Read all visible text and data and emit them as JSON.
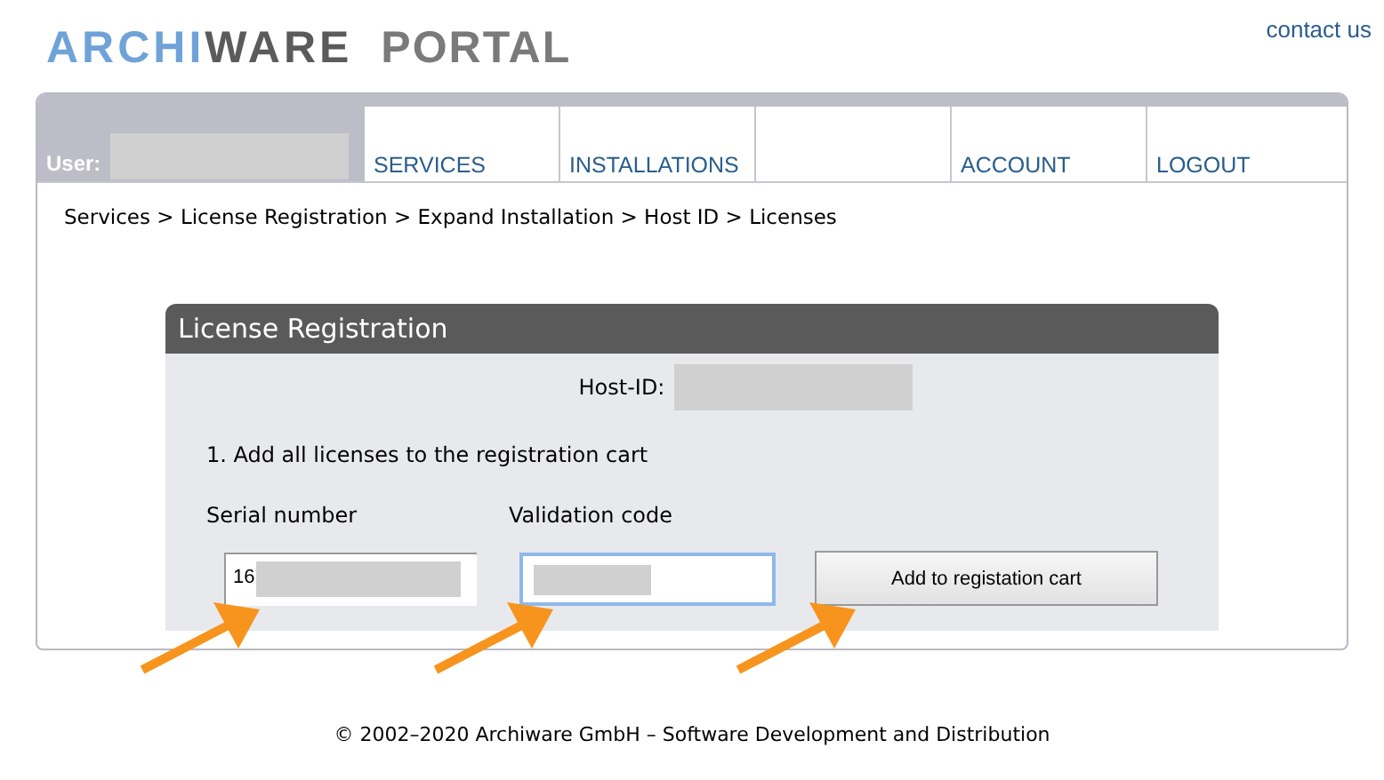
{
  "header": {
    "logo": {
      "part_1": "ARCHI",
      "part_2": "WARE",
      "product": "PORTAL"
    },
    "contact_link": "contact us"
  },
  "nav": {
    "user_label": "User:",
    "items": [
      {
        "kind": "link",
        "label": "SERVICES"
      },
      {
        "kind": "link",
        "label": "INSTALLATIONS"
      },
      {
        "kind": "blank"
      },
      {
        "kind": "link",
        "label": "ACCOUNT"
      },
      {
        "kind": "link",
        "label": "LOGOUT"
      }
    ]
  },
  "breadcrumb": "Services > License Registration > Expand Installation > Host ID > Licenses",
  "card": {
    "title": "License Registration",
    "host_id_label": "Host-ID:",
    "step": "1. Add all licenses to the registration cart",
    "serial": {
      "label": "Serial number",
      "value": "16"
    },
    "validation": {
      "label": "Validation code",
      "focused": true
    },
    "button": "Add to registation cart"
  },
  "footer": "© 2002–2020 Archiware GmbH – Software Development and Distribution"
}
